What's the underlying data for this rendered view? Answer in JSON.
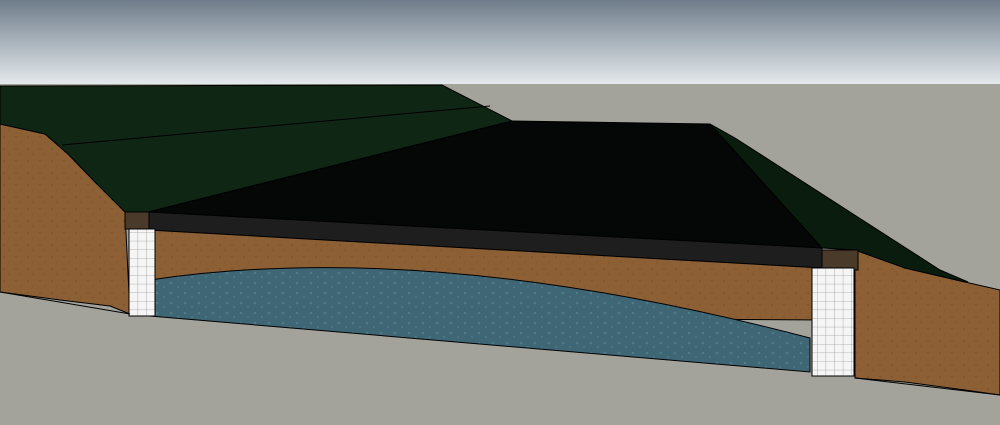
{
  "scene": {
    "colors": {
      "sky_top": "#6f7d8a",
      "sky_bottom": "#e6ebee",
      "ground": "#a3a39c",
      "grass": "#0f2614",
      "grass_dark": "#0a1c0e",
      "lawn": "#040705",
      "road_band": "#1e1e1e",
      "soil": "#8c5f34",
      "soil_dark": "#6a4524",
      "water": "#3f6675",
      "water_light": "#5a8593",
      "pillar": "#f5f5f5",
      "pillar_grid": "#9a9a9a",
      "cap": "#4a3a2a",
      "outline": "#000000"
    }
  }
}
